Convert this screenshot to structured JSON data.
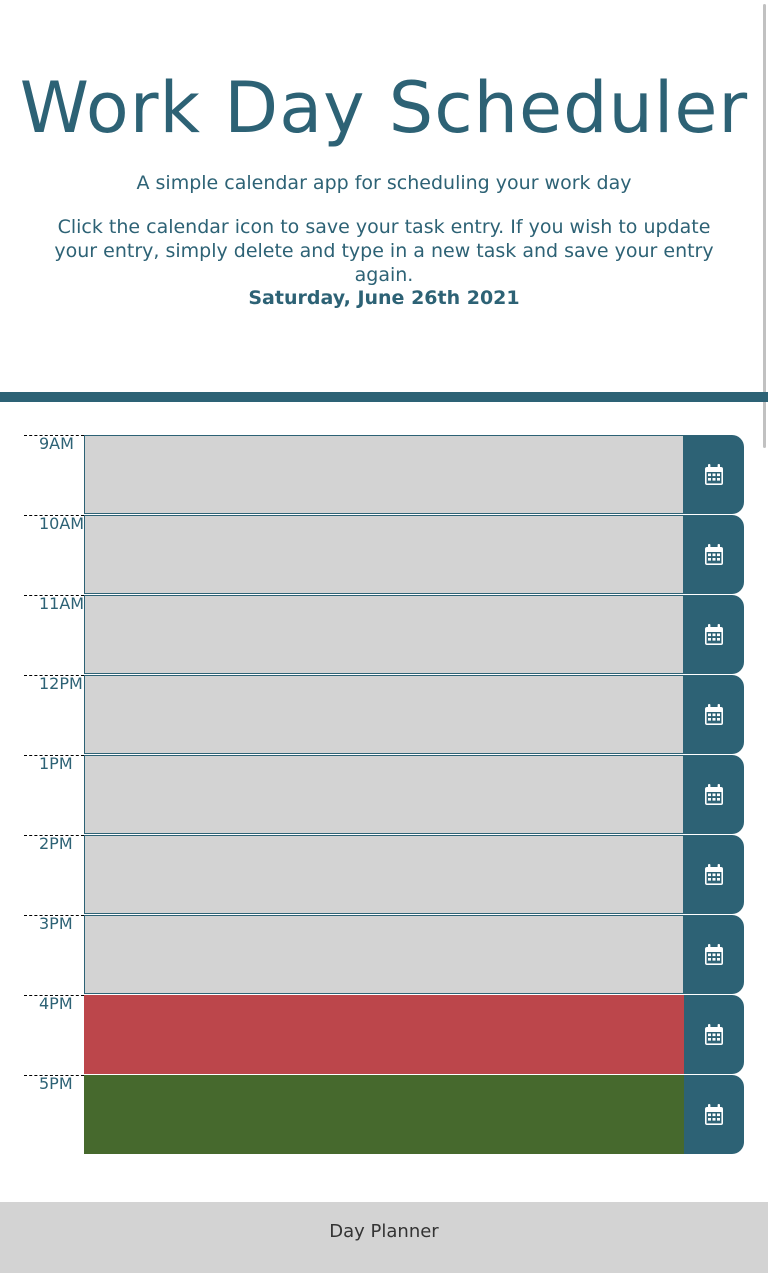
{
  "header": {
    "title": "Work Day Scheduler",
    "subtitle": "A simple calendar app for scheduling your work day",
    "instructions": "Click the calendar icon to save your task entry. If you wish to update your entry, simply delete and type in a new task and save your entry again.",
    "current_day": "Saturday, June 26th 2021"
  },
  "schedule": {
    "rows": [
      {
        "hour": "9AM",
        "status": "past",
        "task": ""
      },
      {
        "hour": "10AM",
        "status": "past",
        "task": ""
      },
      {
        "hour": "11AM",
        "status": "past",
        "task": ""
      },
      {
        "hour": "12PM",
        "status": "past",
        "task": ""
      },
      {
        "hour": "1PM",
        "status": "past",
        "task": ""
      },
      {
        "hour": "2PM",
        "status": "past",
        "task": ""
      },
      {
        "hour": "3PM",
        "status": "past",
        "task": ""
      },
      {
        "hour": "4PM",
        "status": "present",
        "task": ""
      },
      {
        "hour": "5PM",
        "status": "future",
        "task": ""
      }
    ],
    "save_icon": "calendar-save-icon"
  },
  "colors": {
    "accent": "#2d6275",
    "past": "#d3d3d3",
    "present": "#bc464b",
    "future": "#46692d"
  },
  "footer": {
    "text": "Day Planner"
  }
}
